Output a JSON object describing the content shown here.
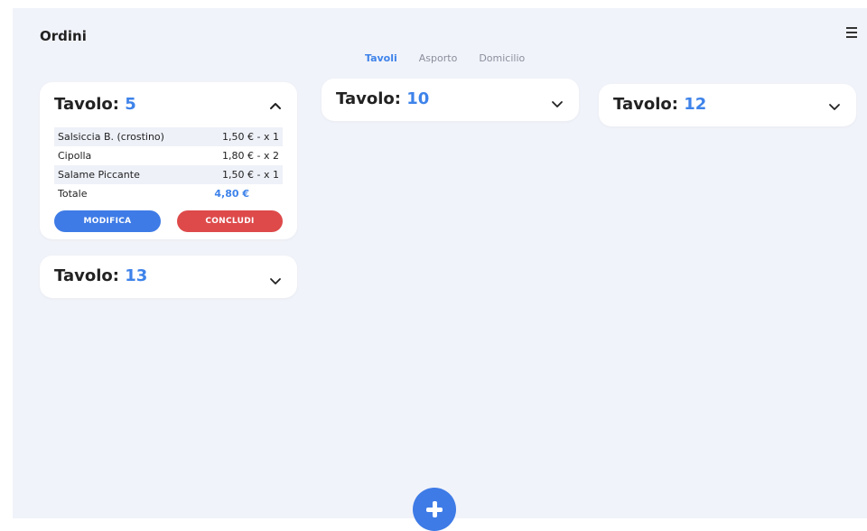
{
  "header": {
    "title": "Ordini",
    "menu_icon": "hamburger-icon"
  },
  "tabs": [
    {
      "label": "Tavoli",
      "active": true
    },
    {
      "label": "Asporto",
      "active": false
    },
    {
      "label": "Domicilio",
      "active": false
    }
  ],
  "tables": [
    {
      "label": "Tavolo:",
      "number": "5",
      "expanded": true,
      "items": [
        {
          "name": "Salsiccia B. (crostino)",
          "price": "1,50 € - x 1"
        },
        {
          "name": "Cipolla",
          "price": "1,80 € - x 2"
        },
        {
          "name": "Salame Piccante",
          "price": "1,50 € - x 1"
        }
      ],
      "total_label": "Totale",
      "total_value": "4,80 €",
      "edit_label": "MODIFICA",
      "close_label": "CONCLUDI"
    },
    {
      "label": "Tavolo:",
      "number": "10",
      "expanded": false
    },
    {
      "label": "Tavolo:",
      "number": "12",
      "expanded": false
    },
    {
      "label": "Tavolo:",
      "number": "13",
      "expanded": false
    }
  ],
  "fab_icon": "plus-icon",
  "colors": {
    "accent": "#3e83ea",
    "danger": "#de4a4a",
    "background": "#f1f3fa"
  }
}
